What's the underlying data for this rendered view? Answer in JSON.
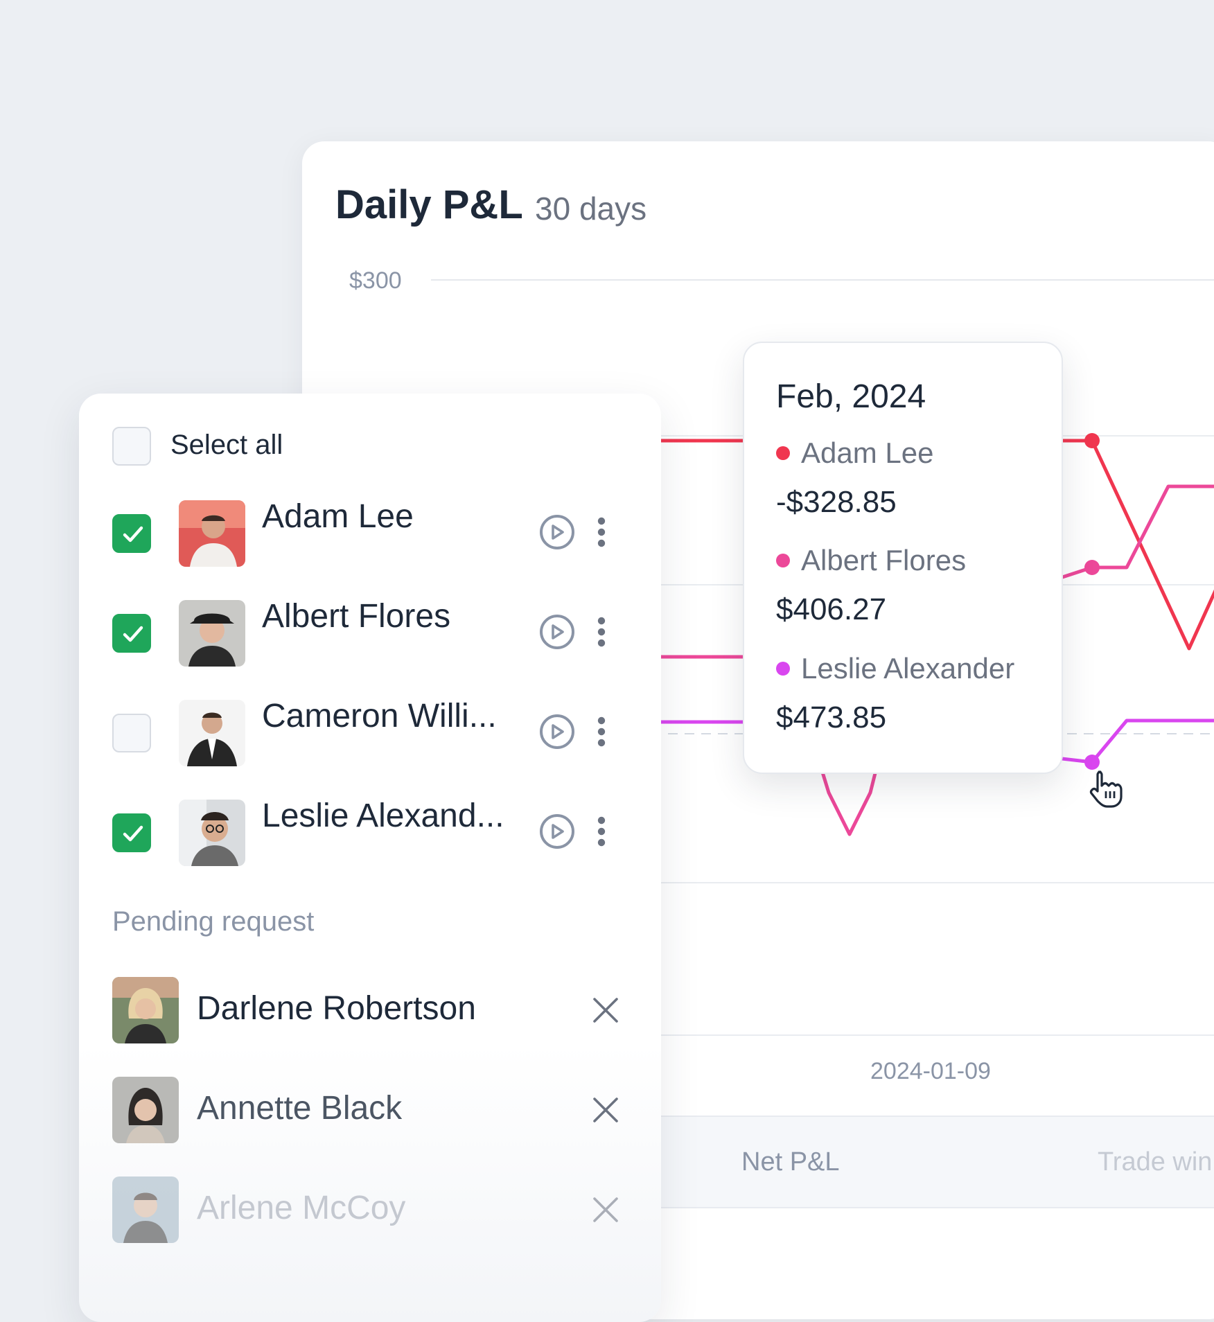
{
  "chart_card": {
    "title": "Daily P&L",
    "subtitle": "30 days",
    "y_tick_top": "$300",
    "x_tick": "2024-01-09",
    "stats": {
      "net_pnl_label": "Net P&L",
      "trade_win_label": "Trade win"
    }
  },
  "tooltip": {
    "title": "Feb, 2024",
    "rows": [
      {
        "name": "Adam Lee",
        "value": "-$328.85",
        "color": "#f0364f"
      },
      {
        "name": "Albert Flores",
        "value": "$406.27",
        "color": "#ec4899"
      },
      {
        "name": "Leslie Alexander",
        "value": "$473.85",
        "color": "#d946ef"
      }
    ]
  },
  "chart_data": {
    "type": "line",
    "title": "Daily P&L",
    "subtitle": "30 days",
    "x": [
      "2024-01-09"
    ],
    "y_ticks": [
      "$300"
    ],
    "series": [
      {
        "name": "Adam Lee",
        "color": "#f0364f",
        "highlight_value": -328.85
      },
      {
        "name": "Albert Flores",
        "color": "#ec4899",
        "highlight_value": 406.27
      },
      {
        "name": "Leslie Alexander",
        "color": "#d946ef",
        "highlight_value": 473.85
      }
    ],
    "highlight_period": "Feb, 2024",
    "grid": true
  },
  "panel": {
    "select_all_label": "Select all",
    "members": [
      {
        "name": "Adam Lee",
        "checked": true
      },
      {
        "name": "Albert Flores",
        "checked": true
      },
      {
        "name": "Cameron Willi...",
        "checked": false
      },
      {
        "name": "Leslie Alexand...",
        "checked": true
      }
    ],
    "pending_label": "Pending request",
    "pending": [
      {
        "name": "Darlene Robertson"
      },
      {
        "name": "Annette Black"
      },
      {
        "name": "Arlene McCoy"
      }
    ]
  },
  "colors": {
    "check_green": "#1fa65a",
    "adam_line": "#f0364f",
    "albert_line": "#ec4899",
    "leslie_line": "#d946ef"
  }
}
